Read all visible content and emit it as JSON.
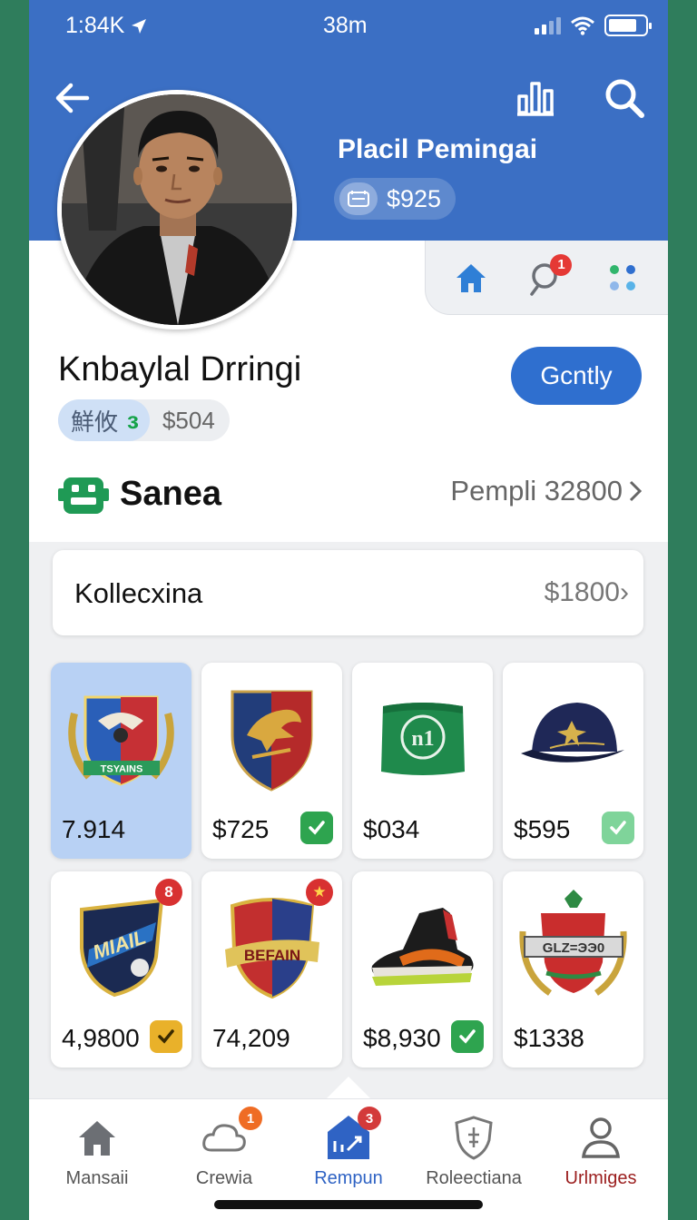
{
  "status_bar": {
    "time": "1:84K",
    "center": "38m"
  },
  "header": {
    "name": "Placil Pemingai",
    "balance": "$925"
  },
  "quick_bar": {
    "chat_badge": "1"
  },
  "profile": {
    "name": "Knbaylal Drringi",
    "follow_label": "Gcntly",
    "tag": "鮮攸",
    "tag_mark": "з",
    "tag_amount": "$504"
  },
  "section": {
    "title": "Sanea",
    "link": "Pempli 32800"
  },
  "collection": {
    "title": "Kollecxina",
    "value": "$1800"
  },
  "items": [
    {
      "price": "7.914",
      "art": "eagle-crest-icon",
      "emblem_text": "TSYAINS"
    },
    {
      "price": "$725",
      "art": "eagle-shield-icon"
    },
    {
      "price": "$034",
      "art": "green-wristband-icon",
      "emblem_text": "n1"
    },
    {
      "price": "$595",
      "art": "navy-cap-icon"
    },
    {
      "price": "4,9800",
      "art": "blue-shield-icon",
      "badge": "8",
      "emblem_text": "MIAIL"
    },
    {
      "price": "74,209",
      "art": "red-shield-icon",
      "badge": "★",
      "emblem_text": "BEFAIN"
    },
    {
      "price": "$8,930",
      "art": "sneaker-icon"
    },
    {
      "price": "$1338",
      "art": "laurel-crest-icon",
      "emblem_text": "GLZ=ЭЭ0"
    }
  ],
  "bottom_nav": [
    {
      "label": "Mansaii"
    },
    {
      "label": "Crewia",
      "badge": "1"
    },
    {
      "label": "Rempun",
      "badge": "3"
    },
    {
      "label": "Roleectiana"
    },
    {
      "label": "Urlmiges"
    }
  ],
  "colors": {
    "brand_blue": "#3b6fc4",
    "accent_blue": "#2f6fcf",
    "green": "#2ea44f",
    "badge_red": "#e53935"
  }
}
